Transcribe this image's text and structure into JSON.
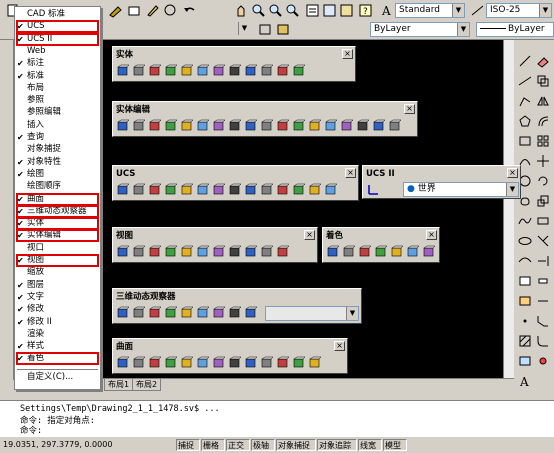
{
  "top_toolbar": {
    "text_style": "Standard",
    "dim_style": "ISO-25",
    "linetype": "ByLayer",
    "lineweight": "ByLayer"
  },
  "menu": {
    "items": [
      {
        "label": "CAD 标准",
        "checked": false
      },
      {
        "label": "UCS",
        "checked": true
      },
      {
        "label": "UCS II",
        "checked": true
      },
      {
        "label": "Web",
        "checked": false
      },
      {
        "label": "标注",
        "checked": true
      },
      {
        "label": "标准",
        "checked": true
      },
      {
        "label": "布局",
        "checked": false
      },
      {
        "label": "参照",
        "checked": false
      },
      {
        "label": "参照编辑",
        "checked": false
      },
      {
        "label": "插入",
        "checked": false
      },
      {
        "label": "查询",
        "checked": true
      },
      {
        "label": "对象捕捉",
        "checked": false
      },
      {
        "label": "对象特性",
        "checked": true
      },
      {
        "label": "绘图",
        "checked": true
      },
      {
        "label": "绘图顺序",
        "checked": false
      },
      {
        "label": "曲面",
        "checked": true
      },
      {
        "label": "三维动态观察器",
        "checked": true
      },
      {
        "label": "实体",
        "checked": true
      },
      {
        "label": "实体编辑",
        "checked": true
      },
      {
        "label": "视口",
        "checked": false
      },
      {
        "label": "视图",
        "checked": true
      },
      {
        "label": "缩放",
        "checked": false
      },
      {
        "label": "图层",
        "checked": true
      },
      {
        "label": "文字",
        "checked": true
      },
      {
        "label": "修改",
        "checked": true
      },
      {
        "label": "修改 II",
        "checked": true
      },
      {
        "label": "渲染",
        "checked": false
      },
      {
        "label": "样式",
        "checked": true
      },
      {
        "label": "着色",
        "checked": true
      },
      {
        "label": "自定义(C)...",
        "checked": false
      }
    ]
  },
  "toolbars": {
    "solid": "实体",
    "solid_edit": "实体编辑",
    "ucs": "UCS",
    "ucs2": "UCS II",
    "ucs2_value": "世界",
    "view": "视图",
    "shade": "着色",
    "orbit": "三维动态观察器",
    "surface": "曲面"
  },
  "tabs": [
    "布局1",
    "布局2"
  ],
  "command_lines": [
    "Settings\\Temp\\Drawing2_1_1_1478.sv$ ...",
    "命令: 指定对角点:",
    "命令:"
  ],
  "status": {
    "coords": "19.0351,  297.3779, 0.0000",
    "buttons": [
      "捕捉",
      "栅格",
      "正交",
      "极轴",
      "对象捕捉",
      "对象追踪",
      "线宽",
      "模型"
    ]
  }
}
